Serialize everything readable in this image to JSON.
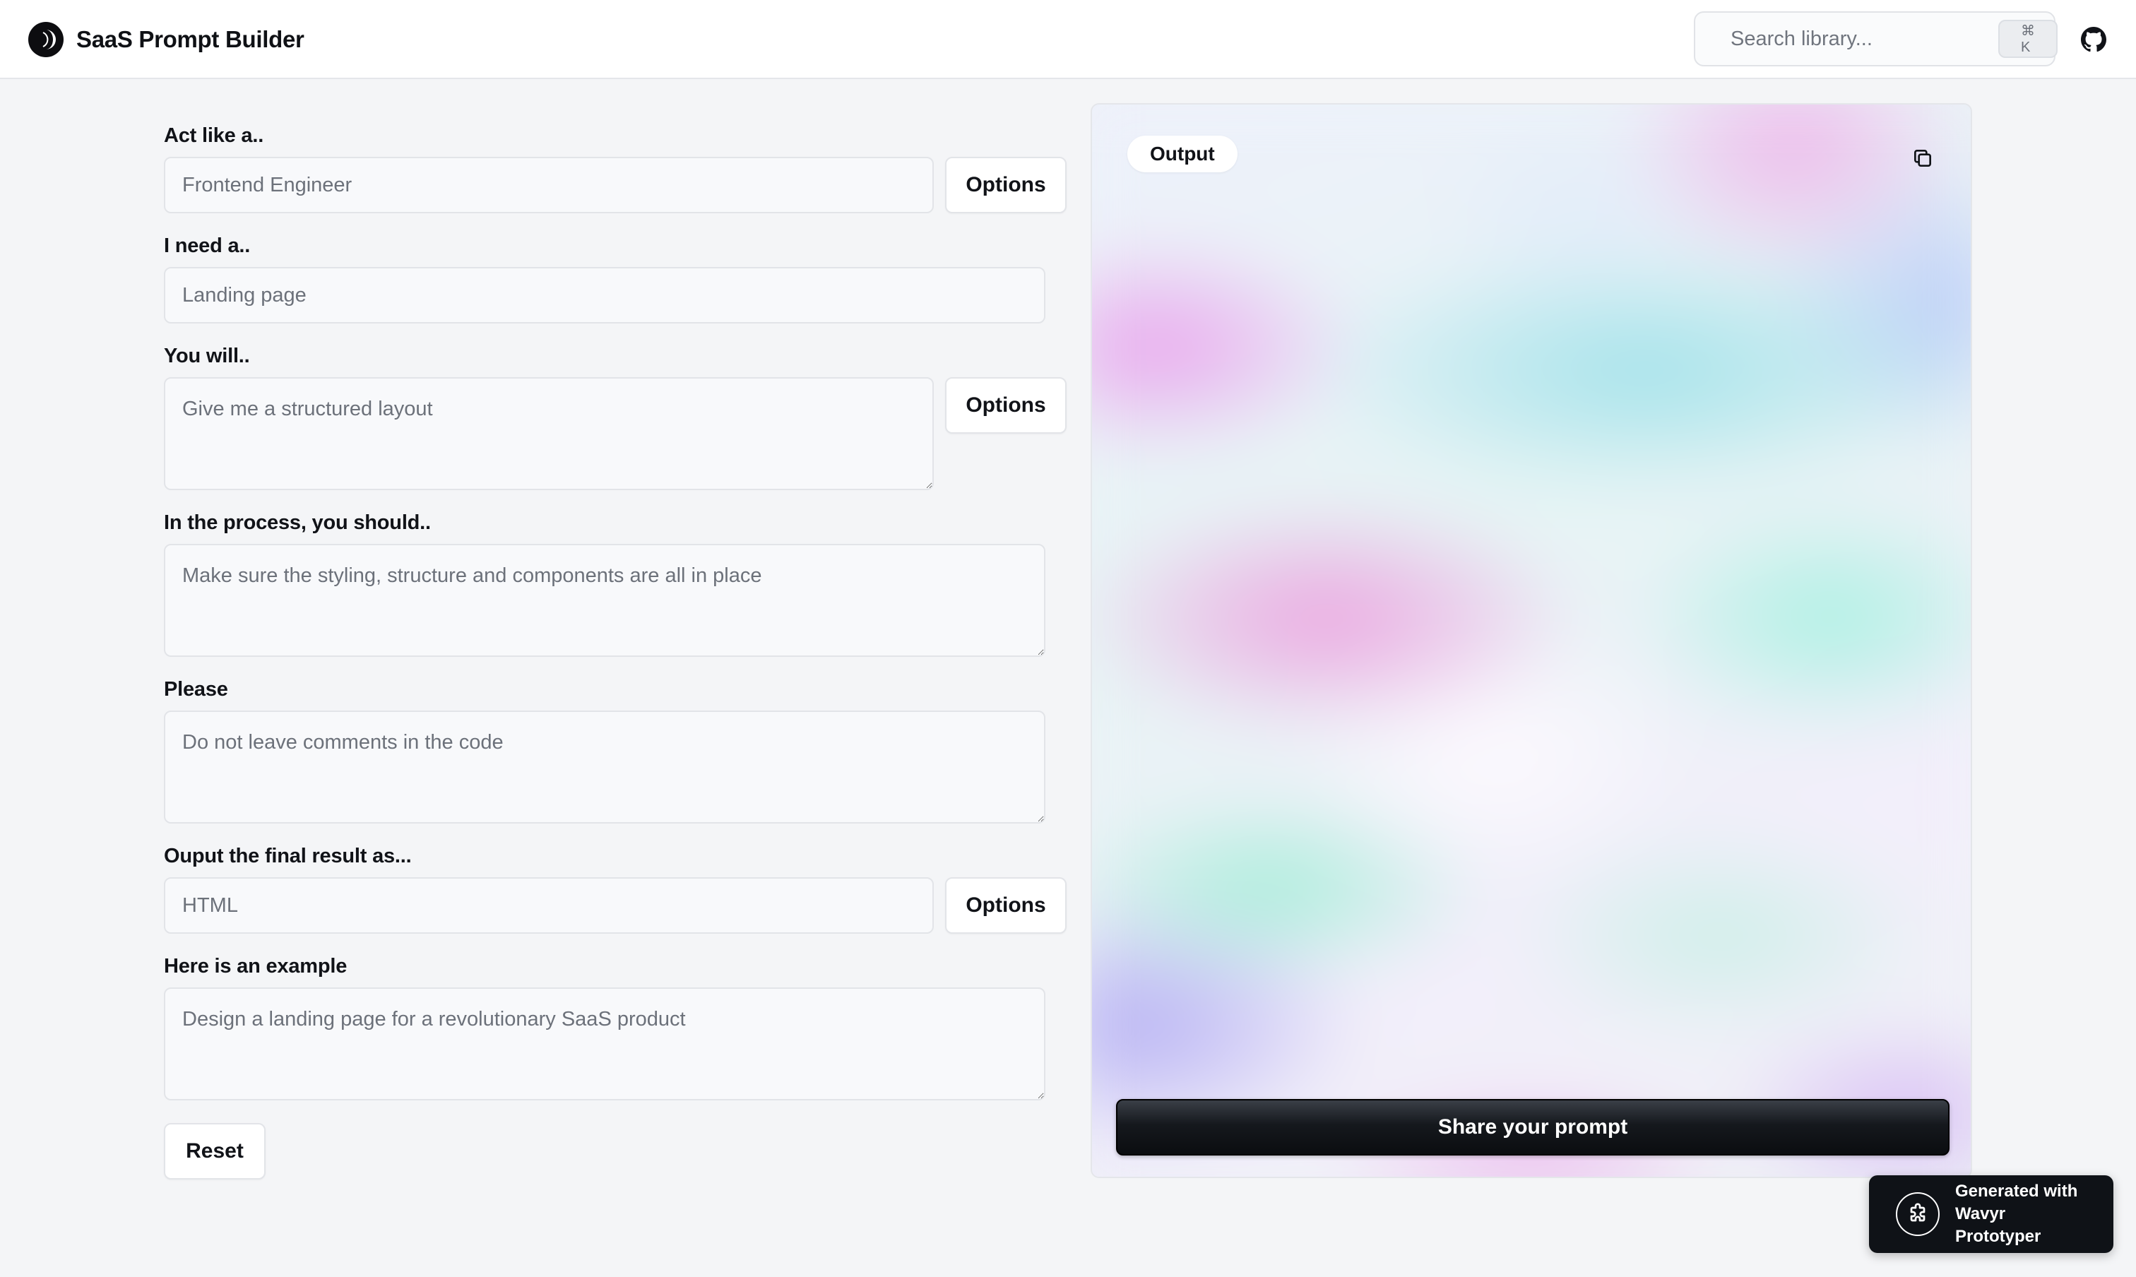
{
  "header": {
    "title": "SaaS Prompt Builder",
    "logo_icon": "crescent-moon-logo-icon",
    "search_placeholder": "Search library...",
    "search_shortcut": "⌘ K",
    "github_icon": "github-icon"
  },
  "form": {
    "act_like": {
      "label": "Act like a..",
      "placeholder": "Frontend Engineer",
      "options_label": "Options"
    },
    "need": {
      "label": "I need a..",
      "placeholder": "Landing page"
    },
    "you_will": {
      "label": "You will..",
      "placeholder": "Give me a structured layout",
      "options_label": "Options"
    },
    "process": {
      "label": "In the process, you should..",
      "placeholder": "Make sure the styling, structure and components are all in place"
    },
    "please": {
      "label": "Please",
      "placeholder": "Do not leave comments in the code"
    },
    "output_format": {
      "label": "Ouput the final result as...",
      "placeholder": "HTML",
      "options_label": "Options"
    },
    "example": {
      "label": "Here is an example",
      "placeholder": "Design a landing page for a revolutionary SaaS product"
    },
    "reset_label": "Reset"
  },
  "output_panel": {
    "title": "Output",
    "copy_icon": "copy-icon",
    "share_label": "Share your prompt"
  },
  "badge": {
    "line1": "Generated with",
    "line2": "Wavyr Prototyper",
    "icon": "puzzle-icon"
  }
}
